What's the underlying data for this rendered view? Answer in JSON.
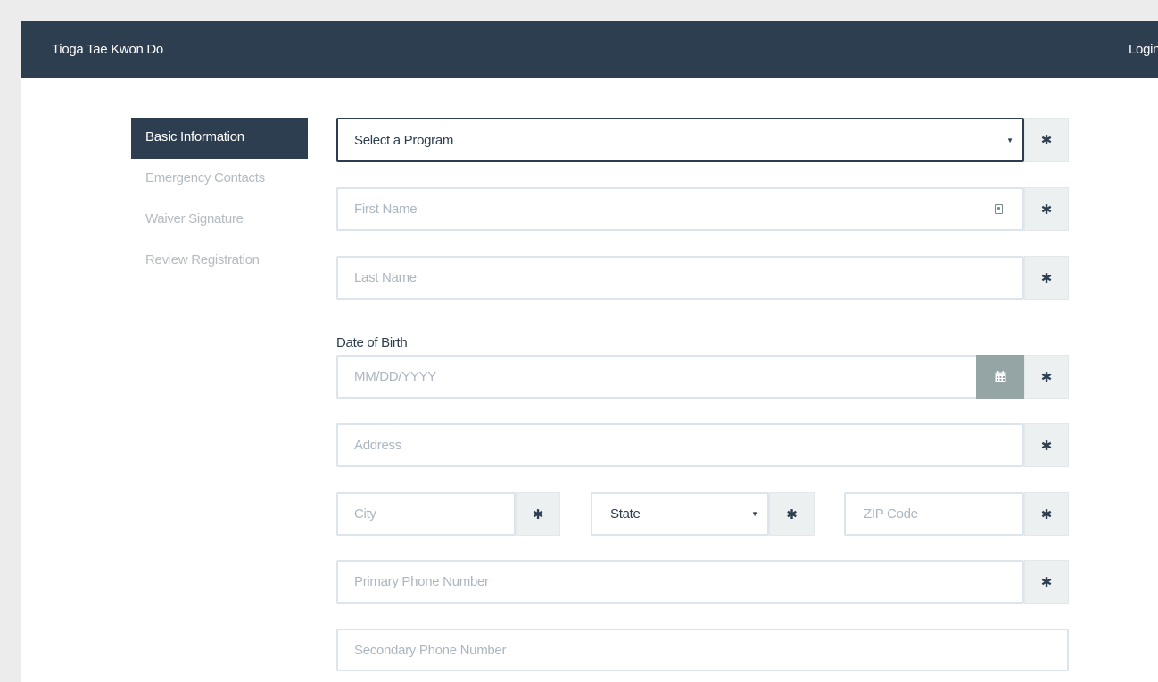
{
  "navbar": {
    "brand": "Tioga Tae Kwon Do",
    "login": "Login"
  },
  "sidebar": {
    "items": [
      {
        "label": "Basic Information",
        "active": true
      },
      {
        "label": "Emergency Contacts",
        "active": false
      },
      {
        "label": "Waiver Signature",
        "active": false
      },
      {
        "label": "Review Registration",
        "active": false
      }
    ]
  },
  "form": {
    "program": {
      "selected": "Select a Program",
      "required": "✱"
    },
    "first_name": {
      "placeholder": "First Name",
      "required": "✱",
      "icon": "contact-card-icon"
    },
    "last_name": {
      "placeholder": "Last Name",
      "required": "✱"
    },
    "dob": {
      "label": "Date of Birth",
      "placeholder": "MM/DD/YYYY",
      "required": "✱",
      "icon": "calendar-icon"
    },
    "address": {
      "placeholder": "Address",
      "required": "✱"
    },
    "city": {
      "placeholder": "City",
      "required": "✱"
    },
    "state": {
      "selected": "State",
      "required": "✱"
    },
    "zip": {
      "placeholder": "ZIP Code",
      "required": "✱"
    },
    "primary_phone": {
      "placeholder": "Primary Phone Number",
      "required": "✱"
    },
    "secondary_phone": {
      "placeholder": "Secondary Phone Number"
    }
  },
  "colors": {
    "navbar": "#2c3e50",
    "active_nav": "#2c3e50",
    "inactive_nav_text": "#b4bcc2",
    "field_border": "#dce4ec",
    "placeholder": "#acb6c0",
    "addon_bg": "#ecf0f1",
    "calendar_button": "#95a5a6"
  }
}
